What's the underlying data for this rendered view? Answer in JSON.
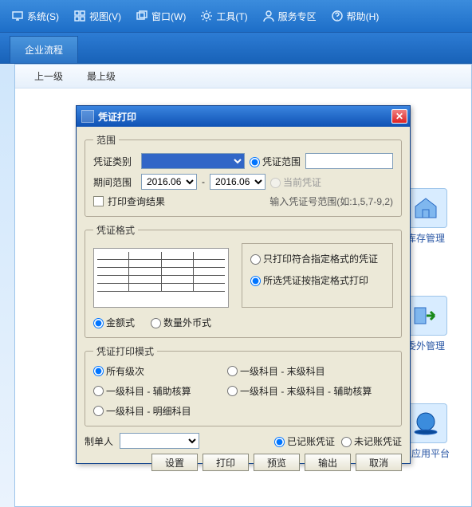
{
  "menu": {
    "system": "系统(S)",
    "view": "视图(V)",
    "window": "窗口(W)",
    "tools": "工具(T)",
    "service": "服务专区",
    "help": "帮助(H)"
  },
  "tab": {
    "enterprise_flow": "企业流程"
  },
  "wf": {
    "up": "上一级",
    "top": "最上级",
    "inventory": "库存管理",
    "outside": "委外管理",
    "app_platform": "业应用平台"
  },
  "dialog": {
    "title": "凭证打印",
    "scope": {
      "legend": "范围",
      "voucher_type": "凭证类别",
      "period": "期间范围",
      "period_from": "2016.06",
      "period_to": "2016.06",
      "range_radio": "凭证范围",
      "current_radio": "当前凭证",
      "range_value": "",
      "print_query": "打印查询结果",
      "hint": "输入凭证号范围(如:1,5,7-9,2)"
    },
    "format": {
      "legend": "凭证格式",
      "opt_match": "只打印符合指定格式的凭证",
      "opt_force": "所选凭证按指定格式打印",
      "amount": "金额式",
      "qtyfx": "数量外币式"
    },
    "mode": {
      "legend": "凭证打印模式",
      "all_levels": "所有级次",
      "l1_end": "一级科目 - 末级科目",
      "l1_aux": "一级科目 - 辅助核算",
      "l1_end_aux": "一级科目 - 末级科目 - 辅助核算",
      "l1_detail": "一级科目 - 明细科目"
    },
    "maker": "制单人",
    "posted": "已记账凭证",
    "unposted": "未记账凭证",
    "buttons": {
      "settings": "设置",
      "print": "打印",
      "preview": "预览",
      "export": "输出",
      "cancel": "取消"
    }
  }
}
